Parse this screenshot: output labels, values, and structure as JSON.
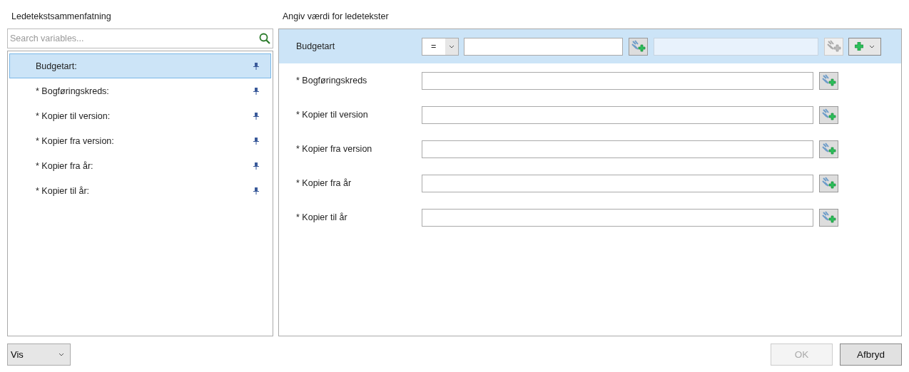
{
  "summary_panel": {
    "title": "Ledetekstsammenfatning",
    "search": {
      "placeholder": "Search variables..."
    },
    "items": [
      {
        "label": "Budgetart:",
        "selected": true
      },
      {
        "label": "* Bogføringskreds:",
        "selected": false
      },
      {
        "label": "* Kopier til version:",
        "selected": false
      },
      {
        "label": "* Kopier fra version:",
        "selected": false
      },
      {
        "label": "* Kopier fra år:",
        "selected": false
      },
      {
        "label": "* Kopier til år:",
        "selected": false
      }
    ]
  },
  "values_panel": {
    "title": "Angiv værdi for ledetekster",
    "prompts": [
      {
        "label": "Budgetart",
        "kind": "range",
        "selected": true,
        "operator": "=",
        "second_field_disabled": true
      },
      {
        "label": "* Bogføringskreds",
        "kind": "simple",
        "selected": false
      },
      {
        "label": "* Kopier til version",
        "kind": "simple",
        "selected": false
      },
      {
        "label": "* Kopier fra version",
        "kind": "simple",
        "selected": false
      },
      {
        "label": "* Kopier fra år",
        "kind": "simple",
        "selected": false
      },
      {
        "label": "* Kopier til år",
        "kind": "simple",
        "selected": false
      }
    ]
  },
  "footer": {
    "view_dropdown": "Vis",
    "ok": {
      "label": "OK",
      "disabled": true
    },
    "cancel": {
      "label": "Afbryd",
      "disabled": false
    }
  }
}
